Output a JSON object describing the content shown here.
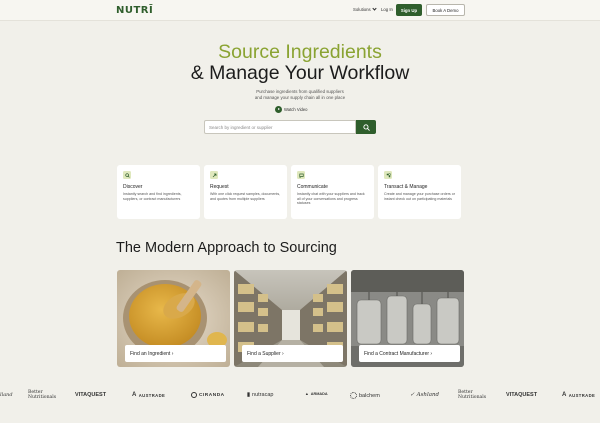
{
  "header": {
    "logo": "NUTRĪ",
    "nav_solutions": "Solutions",
    "nav_login": "Log In",
    "signup": "Sign Up",
    "book_demo": "Book A Demo"
  },
  "hero": {
    "title_line1": "Source Ingredients",
    "title_line2": "& Manage Your Workflow",
    "subtitle_line1": "Purchase ingredients from qualified suppliers",
    "subtitle_line2": "and manage your supply chain all in one place",
    "watch_video": "Watch Video",
    "search_placeholder": "Search by ingredient or supplier"
  },
  "features": [
    {
      "icon": "search-icon",
      "title": "Discover",
      "desc": "Instantly search and find ingredients, suppliers, or contract manufacturers"
    },
    {
      "icon": "request-icon",
      "title": "Request",
      "desc": "With one click request samples, documents, and quotes from multiple suppliers"
    },
    {
      "icon": "chat-icon",
      "title": "Communicate",
      "desc": "Instantly chat with your suppliers and track all of your conversations and progress statuses"
    },
    {
      "icon": "transact-icon",
      "title": "Transact & Manage",
      "desc": "Create and manage your purchase orders or instant check out on participating materials"
    }
  ],
  "section": {
    "title": "The Modern Approach to Sourcing"
  },
  "cards": [
    {
      "image": "ingredient-photo",
      "label": "Find an Ingredient ›"
    },
    {
      "image": "warehouse-photo",
      "label": "Find a Supplier ›"
    },
    {
      "image": "factory-photo",
      "label": "Find a Contract Manufacturer ›"
    }
  ],
  "brands": [
    "lland",
    "Better Nutritionals",
    "VITAQUEST",
    "AUSTRADE",
    "CIRANDA",
    "nutracap",
    "ARMADA",
    "balchem",
    "Ashland",
    "Better Nutritionals",
    "VITAQUEST",
    "AUSTRADE"
  ],
  "colors": {
    "brand_green": "#2f5e2c",
    "accent_olive": "#8aa332",
    "background": "#f1f0ea"
  }
}
